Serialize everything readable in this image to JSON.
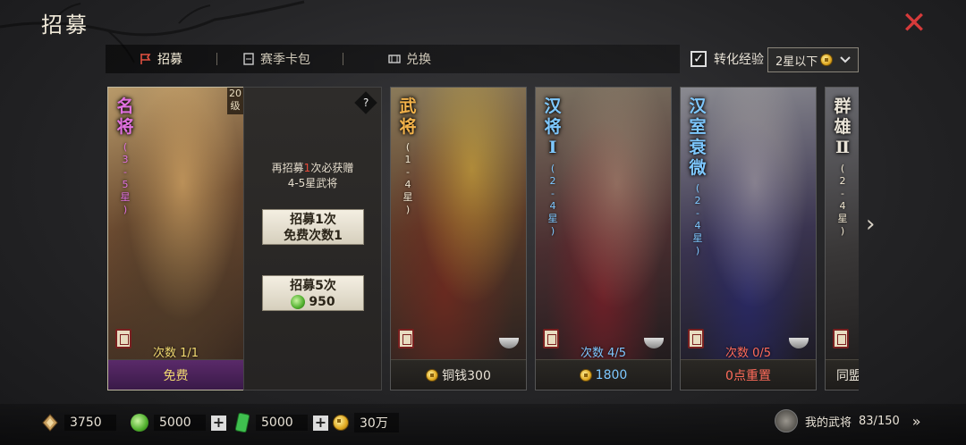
{
  "header": {
    "title": "招募"
  },
  "tabs": [
    {
      "label": "招募"
    },
    {
      "label": "赛季卡包"
    },
    {
      "label": "兑换"
    }
  ],
  "convert": {
    "label": "转化经验",
    "checked": true,
    "dropdown_value": "2星以下"
  },
  "famous_card": {
    "title_chars": [
      "名",
      "将"
    ],
    "subtitle_chars": [
      "(",
      "3",
      "-",
      "5",
      "星",
      ")"
    ],
    "level_badge": [
      "20",
      "级"
    ],
    "count": "次数 1/1",
    "footer": "免费",
    "promo_line1_prefix": "再招募",
    "promo_line1_num": "1",
    "promo_line1_suffix": "次必获赠",
    "promo_line2": "4-5星武将",
    "btn1_line1": "招募1次",
    "btn1_line2": "免费次数1",
    "btn5_line1": "招募5次",
    "btn5_cost": "950"
  },
  "cards": [
    {
      "title_chars": [
        "武",
        "将"
      ],
      "subtitle_chars": [
        "(",
        "1",
        "-",
        "4",
        "星",
        ")"
      ],
      "count": "",
      "footer": "铜钱300",
      "title_color": "#f2b24a",
      "footer_color": "#f0e6d0"
    },
    {
      "title_chars": [
        "汉",
        "将",
        "Ⅰ"
      ],
      "subtitle_chars": [
        "(",
        "2",
        "-",
        "4",
        "星",
        ")"
      ],
      "count": "次数 4/5",
      "footer": "1800",
      "title_color": "#7ec8ff",
      "footer_color": "#7ec8ff"
    },
    {
      "title_chars": [
        "汉",
        "室",
        "衰",
        "微"
      ],
      "subtitle_chars": [
        "(",
        "2",
        "-",
        "4",
        "星",
        ")"
      ],
      "count": "次数 0/5",
      "footer": "0点重置",
      "title_color": "#7ec8ff",
      "footer_color": "#ff6b5a"
    },
    {
      "title_chars": [
        "群",
        "雄",
        "Ⅱ"
      ],
      "subtitle_chars": [
        "(",
        "2",
        "-",
        "4",
        "星",
        ")"
      ],
      "count": "",
      "footer": "同盟",
      "title_color": "#e8e2d6",
      "footer_color": "#f0e6d0"
    }
  ],
  "resources": {
    "tokens": "3750",
    "jade": "5000",
    "tickets": "5000",
    "coins": "30万"
  },
  "my_generals": {
    "label": "我的武将",
    "count": "83/150"
  }
}
